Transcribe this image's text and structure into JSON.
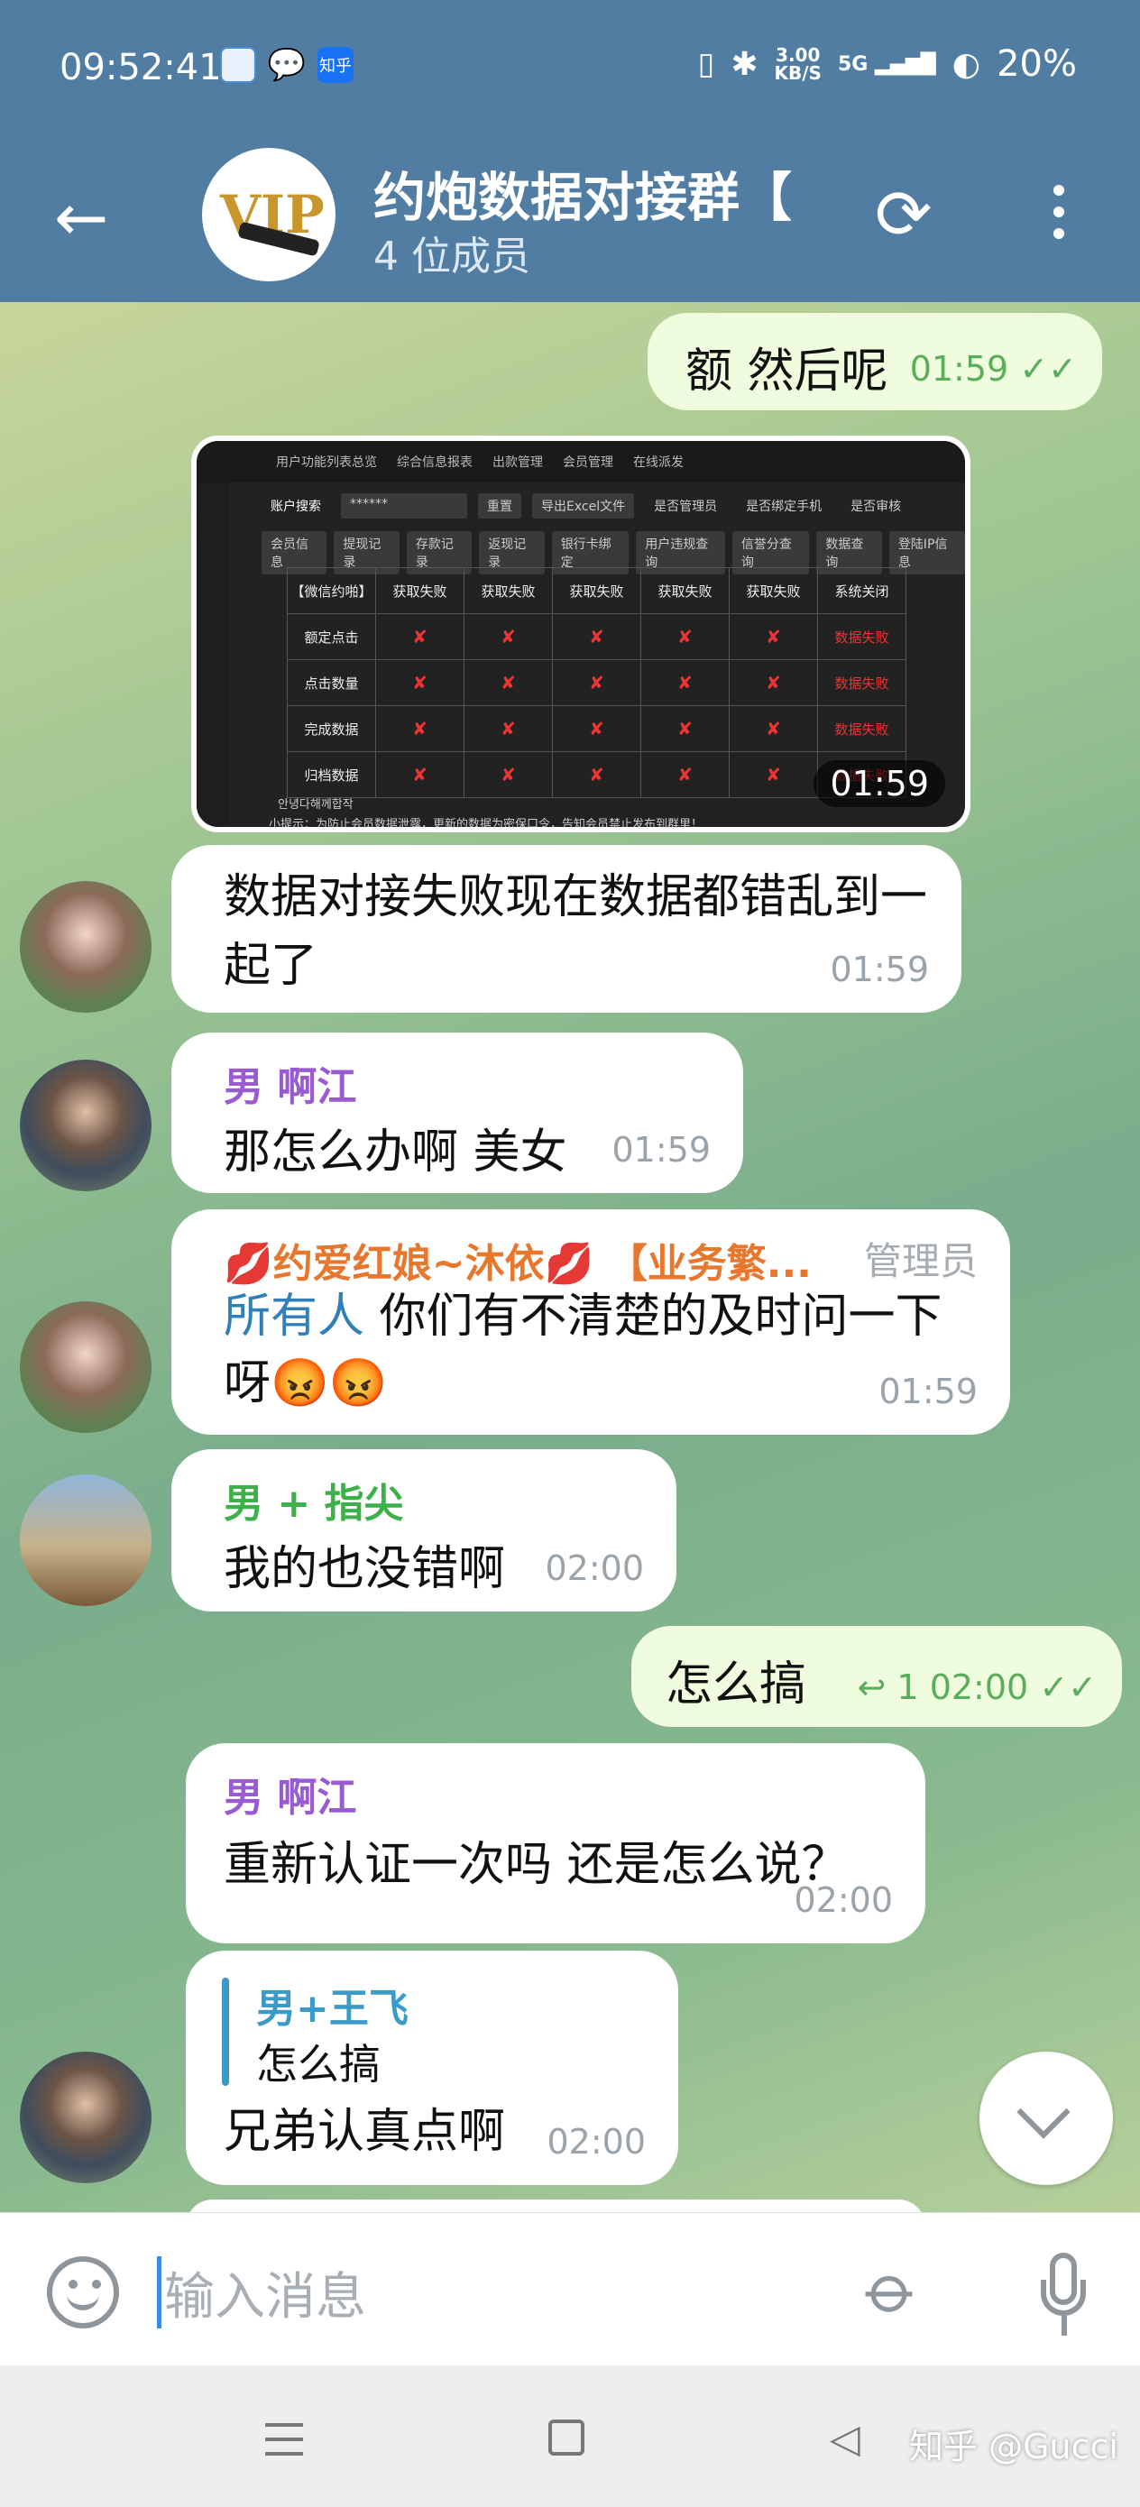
{
  "status_bar": {
    "time": "09:52:41",
    "app_icon_3_label": "知乎",
    "net_speed": "3.00",
    "net_unit": "KB/S",
    "signal": "5G",
    "battery": "20%"
  },
  "header": {
    "avatar_text": "VIP",
    "title": "约炮数据对接群【",
    "subtitle": "4 位成员"
  },
  "messages": [
    {
      "text": "额 然后呢",
      "time": "01:59"
    },
    {
      "time": "01:59",
      "screenshot": {
        "tabs": [
          "用户功能列表总览",
          "综合信息报表",
          "出款管理",
          "会员管理",
          "在线派发"
        ],
        "search_label": "账户搜索",
        "search_value": "******",
        "reset": "重置",
        "export": "导出Excel文件",
        "toggles": [
          "是否管理员",
          "是否绑定手机",
          "是否审核"
        ],
        "buttons": [
          "会员信息",
          "提现记录",
          "存款记录",
          "返现记录",
          "银行卡绑定",
          "用户违规查询",
          "信誉分查询",
          "数据查询",
          "登陆IP信息"
        ],
        "table_headers": [
          "【微信约啪】",
          "获取失败",
          "获取失败",
          "获取失败",
          "获取失败",
          "获取失败",
          "系统关闭"
        ],
        "rows": [
          {
            "label": "额定点击",
            "status": "数据失败"
          },
          {
            "label": "点击数量",
            "status": "数据失败"
          },
          {
            "label": "完成数据",
            "status": "数据失败"
          },
          {
            "label": "归档数据",
            "status": "数据失败"
          }
        ],
        "cell_mark": "✘",
        "footer_1": "안녕다해께합작",
        "footer_2": "小提示：为防止会员数据泄露，更新的数据为密保口令，告知会员禁止发布到群里！"
      }
    },
    {
      "text": "数据对接失败现在数据都错乱到一起了",
      "time": "01:59"
    },
    {
      "name": "男 啊江",
      "text": "那怎么办啊 美女",
      "time": "01:59"
    },
    {
      "name": "💋约爱红娘~沐依💋 【业务繁...",
      "role": "管理员",
      "mention": "所有人",
      "text": " 你们有不清楚的及时问一下呀😡😡",
      "time": "01:59"
    },
    {
      "name": "男 + 指尖",
      "text": "我的也没错啊",
      "time": "02:00"
    },
    {
      "text": "怎么搞",
      "reply_count": "1",
      "time": "02:00"
    },
    {
      "name": "男 啊江",
      "text": "重新认证一次吗 还是怎么说？",
      "time": "02:00"
    },
    {
      "reply_name": "男+王飞",
      "reply_text": "怎么搞",
      "text": "兄弟认真点啊",
      "time": "02:00"
    }
  ],
  "input": {
    "placeholder": "输入消息"
  },
  "watermark": "知乎 @Gucci",
  "colors": {
    "header": "#517da2",
    "outgoing_bubble": "#effdde",
    "check": "#5aae5b",
    "name_purple": "#9a5bd2",
    "name_green": "#3db04a",
    "name_orange": "#e8772e",
    "mention_blue": "#2f7fb8"
  }
}
